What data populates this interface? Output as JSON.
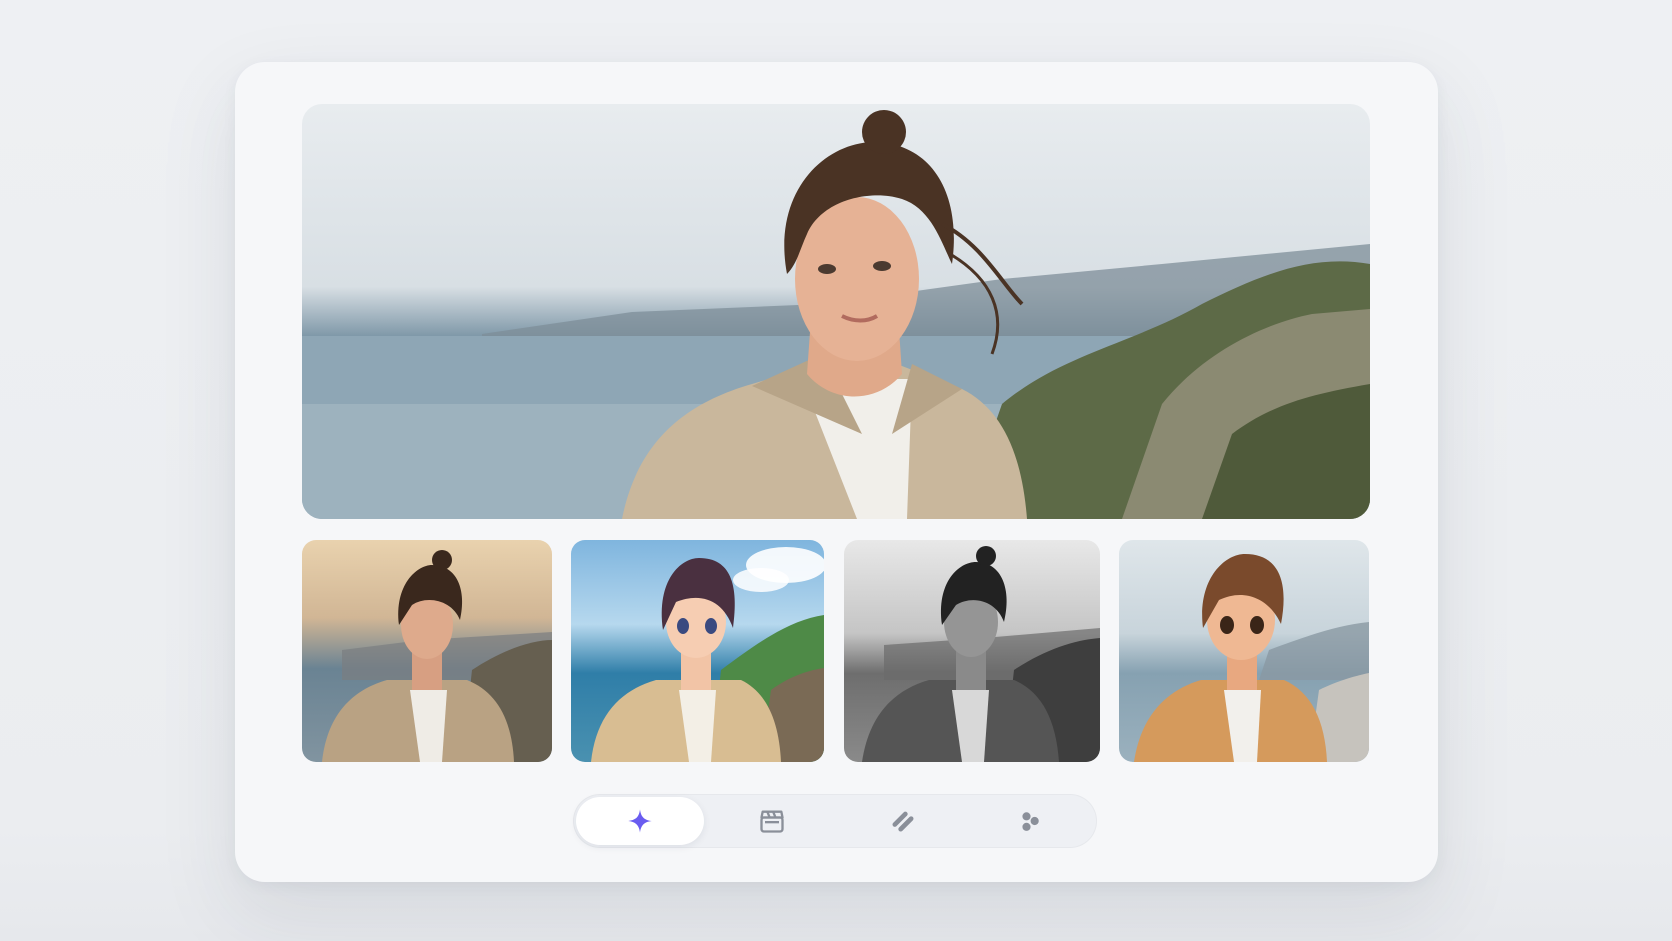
{
  "gallery": {
    "hero_image": "portrait-woman-coastal-cliffs",
    "thumbnails": [
      {
        "style": "photographic-golden-hour"
      },
      {
        "style": "anime-illustration"
      },
      {
        "style": "black-and-white"
      },
      {
        "style": "3d-cartoon"
      }
    ]
  },
  "toolbar": {
    "tools": [
      {
        "icon": "sparkle-icon",
        "active": true
      },
      {
        "icon": "clapperboard-icon",
        "active": false
      },
      {
        "icon": "slashes-icon",
        "active": false
      },
      {
        "icon": "dots-cluster-icon",
        "active": false
      }
    ]
  },
  "colors": {
    "accent": "#6a5cf0",
    "icon_inactive": "#8a8f99",
    "card_bg": "#f6f7f9"
  }
}
